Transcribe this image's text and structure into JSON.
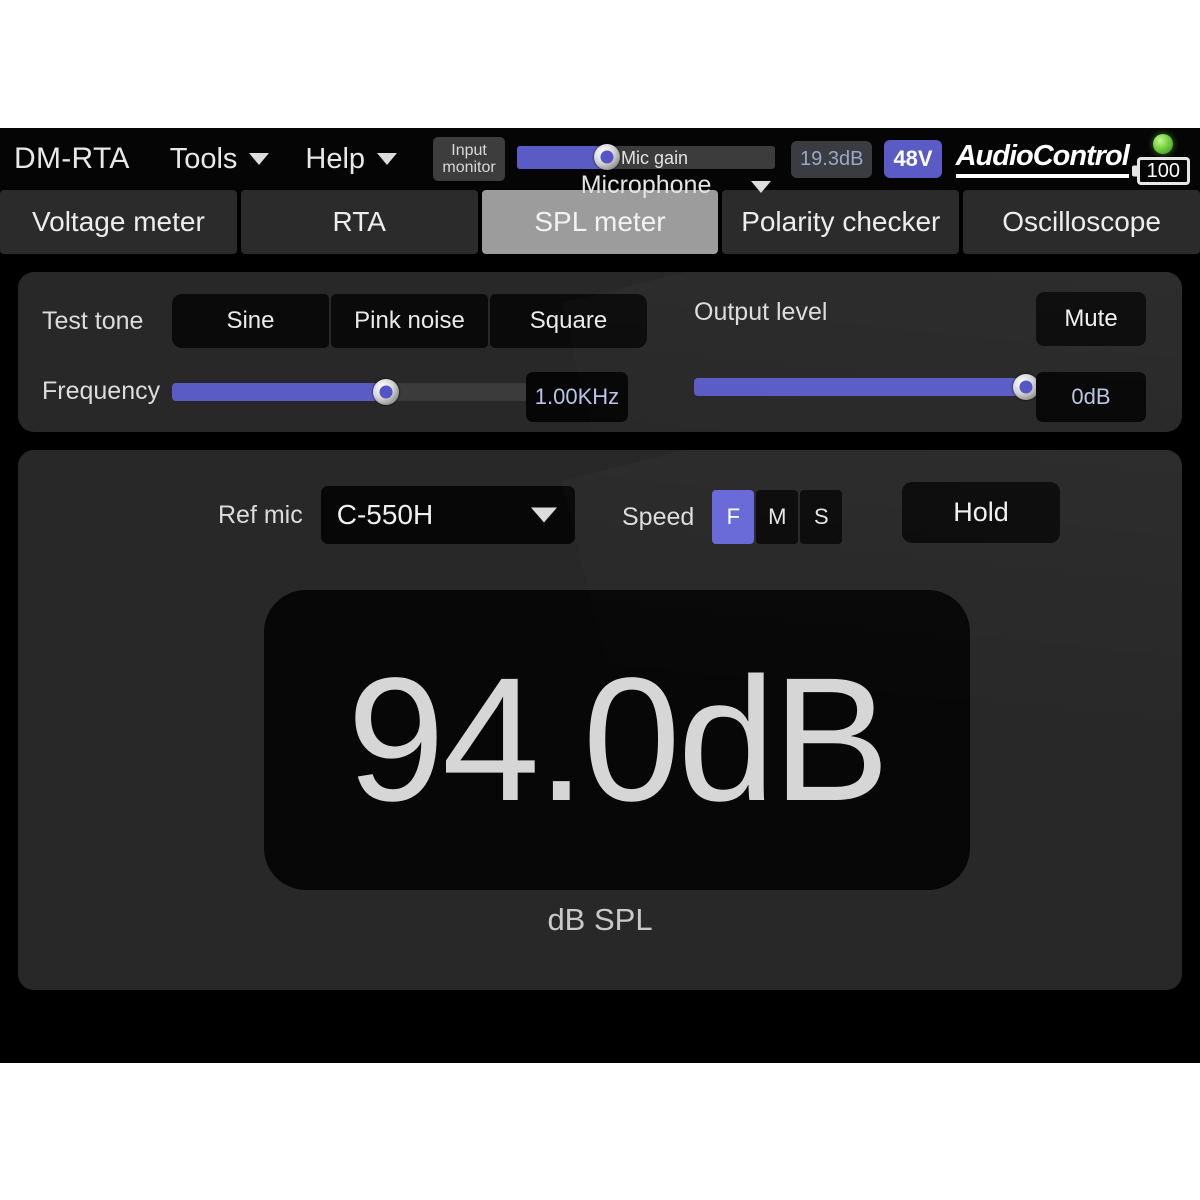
{
  "header": {
    "app_title": "DM-RTA",
    "menus": [
      {
        "label": "Tools",
        "icon": "chevron-down-icon"
      },
      {
        "label": "Help",
        "icon": "chevron-down-icon"
      }
    ],
    "input_monitor": {
      "line1": "Input",
      "line2": "monitor"
    },
    "mic_gain": {
      "label": "Mic gain",
      "value_percent": 35,
      "source_label": "Microphone"
    },
    "gain_badge": "19.3dB",
    "phantom_badge": "48V",
    "brand": "AudioControl",
    "led": {
      "name": "power-led",
      "color": "#74d23c"
    },
    "battery": "100"
  },
  "tabs": [
    {
      "label": "Voltage meter",
      "active": false
    },
    {
      "label": "RTA",
      "active": false
    },
    {
      "label": "SPL meter",
      "active": true
    },
    {
      "label": "Polarity checker",
      "active": false
    },
    {
      "label": "Oscilloscope",
      "active": false
    }
  ],
  "test_tone": {
    "label": "Test tone",
    "options": [
      "Sine",
      "Pink noise",
      "Square"
    ],
    "frequency_label": "Frequency",
    "frequency_percent": 60,
    "frequency_value": "1.00KHz"
  },
  "output": {
    "label": "Output level",
    "mute_label": "Mute",
    "level_percent": 100,
    "level_value": "0dB"
  },
  "spl": {
    "ref_mic_label": "Ref mic",
    "ref_mic_value": "C-550H",
    "speed_label": "Speed",
    "speed_options": [
      {
        "label": "F",
        "active": true
      },
      {
        "label": "M",
        "active": false
      },
      {
        "label": "S",
        "active": false
      }
    ],
    "hold_label": "Hold",
    "reading": "94.0dB",
    "reading_unit": "dB SPL"
  },
  "colors": {
    "accent": "#5b5bc6",
    "accent_active": "#6868d8",
    "panel": "#282828",
    "tab_active": "#9c9c9c",
    "value_text": "#b9c4e4",
    "led_green": "#74d23c"
  }
}
